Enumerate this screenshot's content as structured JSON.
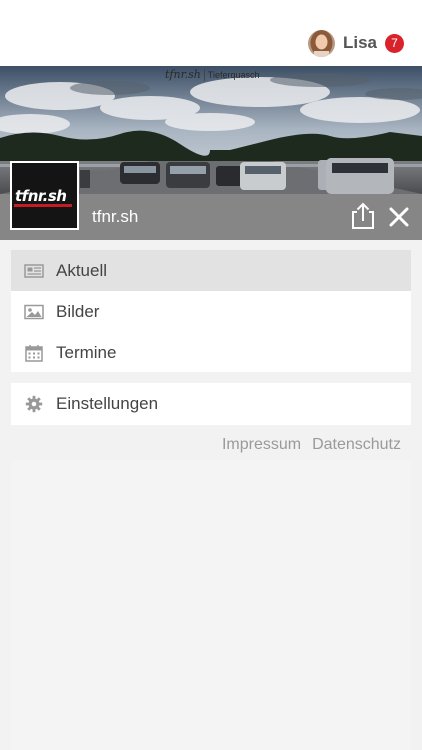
{
  "user": {
    "name": "Lisa",
    "notifications": "7"
  },
  "banner": {
    "watermark_main": "tfnr.sh",
    "watermark_sub": "Tieferquasch"
  },
  "page": {
    "name": "tfnr.sh",
    "logo_text": "tfnr.sh"
  },
  "menu_main": [
    {
      "label": "Aktuell",
      "icon": "newspaper-icon",
      "active": true
    },
    {
      "label": "Bilder",
      "icon": "image-icon",
      "active": false
    },
    {
      "label": "Termine",
      "icon": "calendar-icon",
      "active": false
    }
  ],
  "menu_secondary": [
    {
      "label": "Einstellungen",
      "icon": "gear-icon"
    }
  ],
  "footer": {
    "impressum": "Impressum",
    "datenschutz": "Datenschutz"
  },
  "colors": {
    "badge": "#d9232a",
    "titlebar": "#868686",
    "active_item": "#e2e2e2"
  }
}
